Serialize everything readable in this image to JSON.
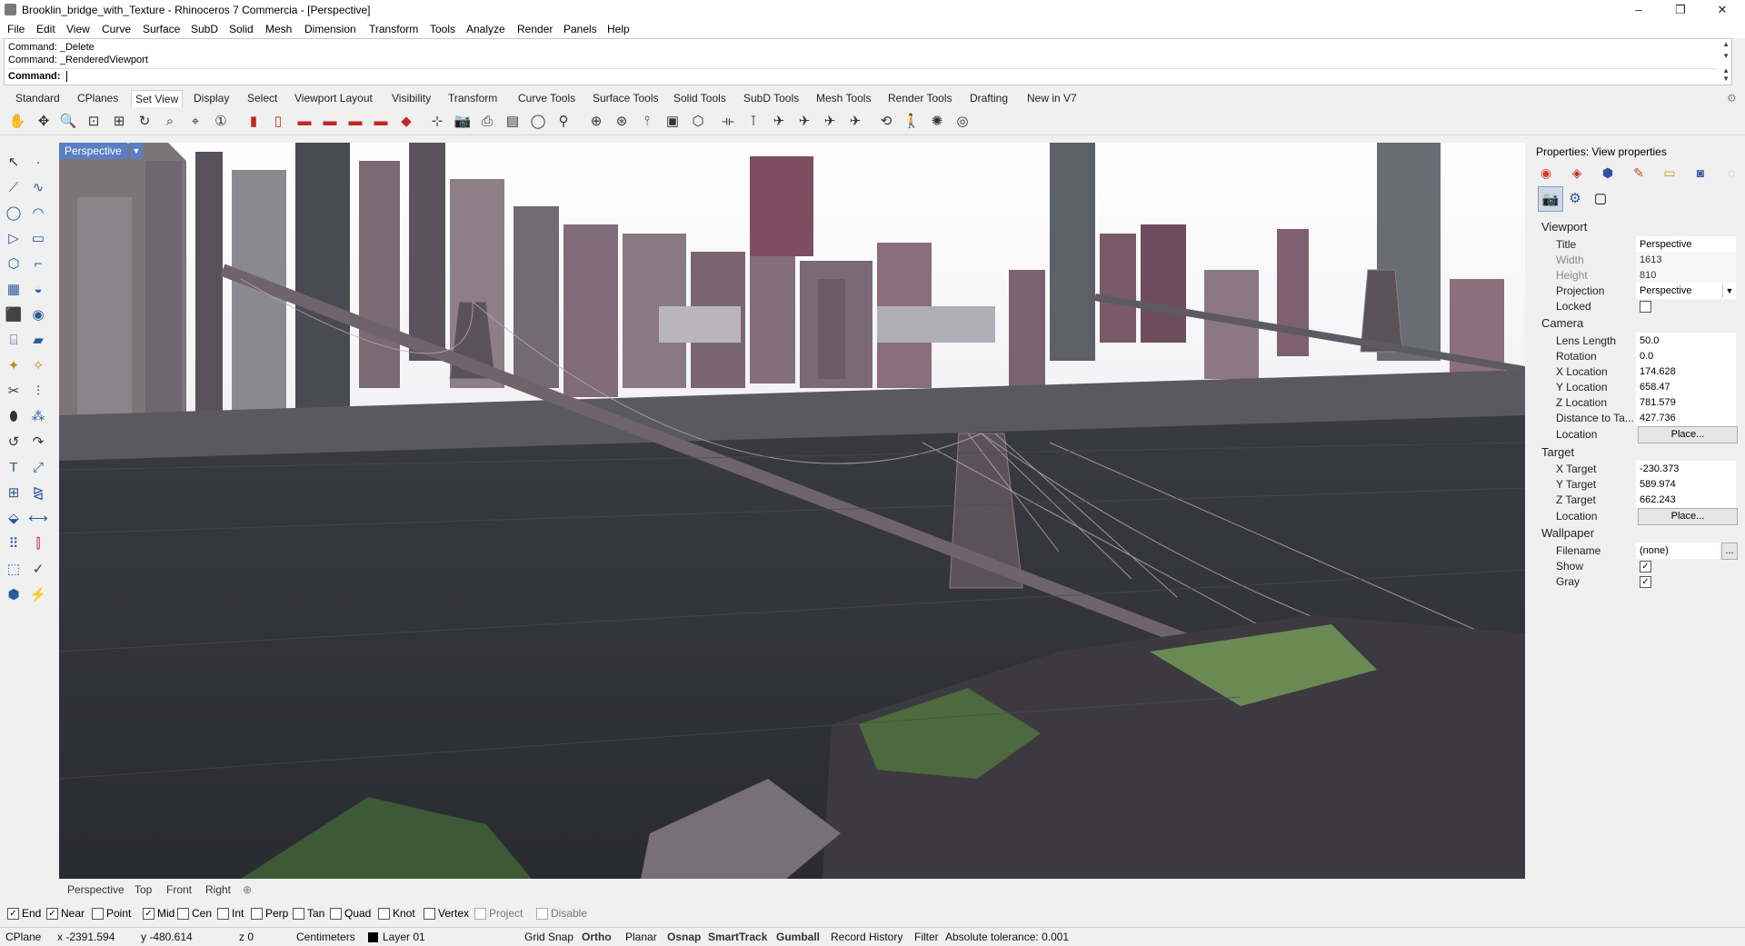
{
  "window": {
    "title": "Brooklin_bridge_with_Texture - Rhinoceros 7 Commercia - [Perspective]",
    "minimize": "–",
    "maximize": "❐",
    "close": "✕"
  },
  "menu": [
    "File",
    "Edit",
    "View",
    "Curve",
    "Surface",
    "SubD",
    "Solid",
    "Mesh",
    "Dimension",
    "Transform",
    "Tools",
    "Analyze",
    "Render",
    "Panels",
    "Help"
  ],
  "command": {
    "history": [
      "Command: _Delete",
      "Command: _RenderedViewport"
    ],
    "prompt": "Command:",
    "value": ""
  },
  "toolbar_tabs": [
    "Standard",
    "CPlanes",
    "Set View",
    "Display",
    "Select",
    "Viewport Layout",
    "Visibility",
    "Transform",
    "Curve Tools",
    "Surface Tools",
    "Solid Tools",
    "SubD Tools",
    "Mesh Tools",
    "Render Tools",
    "Drafting",
    "New in V7"
  ],
  "active_toolbar_tab": "Set View",
  "toolbar_icons": [
    "pan-icon",
    "rotate-view-icon",
    "zoom-dynamic-icon",
    "zoom-extents-icon",
    "zoom-extents-all-icon",
    "rotate-camera-icon",
    "zoom-window-icon",
    "zoom-selected-icon",
    "1to1-zoom-icon",
    "named-view-icon",
    "named-view-2-icon",
    "car-front-icon",
    "car-side-icon",
    "car-side-2-icon",
    "car-top-icon",
    "car-perspective-icon",
    "camera-target-icon",
    "camera-icon",
    "print-view-icon",
    "named-cplane-icon",
    "sphere-view-icon",
    "lens-icon",
    "target-icon",
    "zoom-target-icon",
    "set-camera-icon",
    "place-target-icon",
    "cube-view-icon",
    "lens-length-icon",
    "walkabout-icon",
    "plane-view-icon",
    "plane-view-2-icon",
    "plane-view-3-icon",
    "plane-view-4-icon",
    "plane-view-5-icon",
    "undo-view-icon",
    "walk-icon",
    "sun-icon",
    "compass-icon"
  ],
  "viewport": {
    "label": "Perspective",
    "dropdown": "▼"
  },
  "view_tabs": [
    "Perspective",
    "Top",
    "Front",
    "Right"
  ],
  "osnaps": [
    {
      "label": "End",
      "checked": true
    },
    {
      "label": "Near",
      "checked": true
    },
    {
      "label": "Point",
      "checked": false
    },
    {
      "label": "Mid",
      "checked": true
    },
    {
      "label": "Cen",
      "checked": false
    },
    {
      "label": "Int",
      "checked": false
    },
    {
      "label": "Perp",
      "checked": false
    },
    {
      "label": "Tan",
      "checked": false
    },
    {
      "label": "Quad",
      "checked": false
    },
    {
      "label": "Knot",
      "checked": false
    },
    {
      "label": "Vertex",
      "checked": false
    },
    {
      "label": "Project",
      "checked": false
    },
    {
      "label": "Disable",
      "checked": false
    }
  ],
  "status": {
    "cplane": "CPlane",
    "x": "x -2391.594",
    "y": "y -480.614",
    "z": "z 0",
    "units": "Centimeters",
    "layer": "Layer 01",
    "grid_snap": "Grid Snap",
    "ortho": "Ortho",
    "planar": "Planar",
    "osnap": "Osnap",
    "smarttrack": "SmartTrack",
    "gumball": "Gumball",
    "record_history": "Record History",
    "filter": "Filter",
    "tolerance": "Absolute tolerance: 0.001"
  },
  "properties": {
    "title": "Properties: View properties",
    "viewport_section": "Viewport",
    "title_label": "Title",
    "title_value": "Perspective",
    "width_label": "Width",
    "width_value": "1613",
    "height_label": "Height",
    "height_value": "810",
    "projection_label": "Projection",
    "projection_value": "Perspective",
    "locked_label": "Locked",
    "camera_section": "Camera",
    "lens_label": "Lens Length",
    "lens_value": "50.0",
    "rotation_label": "Rotation",
    "rotation_value": "0.0",
    "xloc_label": "X Location",
    "xloc_value": "174.628",
    "yloc_label": "Y Location",
    "yloc_value": "658.47",
    "zloc_label": "Z Location",
    "zloc_value": "781.579",
    "dist_label": "Distance to Ta...",
    "dist_value": "427.736",
    "location_label": "Location",
    "place_button": "Place...",
    "target_section": "Target",
    "xt_label": "X Target",
    "xt_value": "-230.373",
    "yt_label": "Y Target",
    "yt_value": "589.974",
    "zt_label": "Z Target",
    "zt_value": "662.243",
    "tlocation_label": "Location",
    "tplace_button": "Place...",
    "wallpaper_section": "Wallpaper",
    "filename_label": "Filename",
    "filename_value": "(none)",
    "browse_button": "...",
    "show_label": "Show",
    "gray_label": "Gray"
  }
}
